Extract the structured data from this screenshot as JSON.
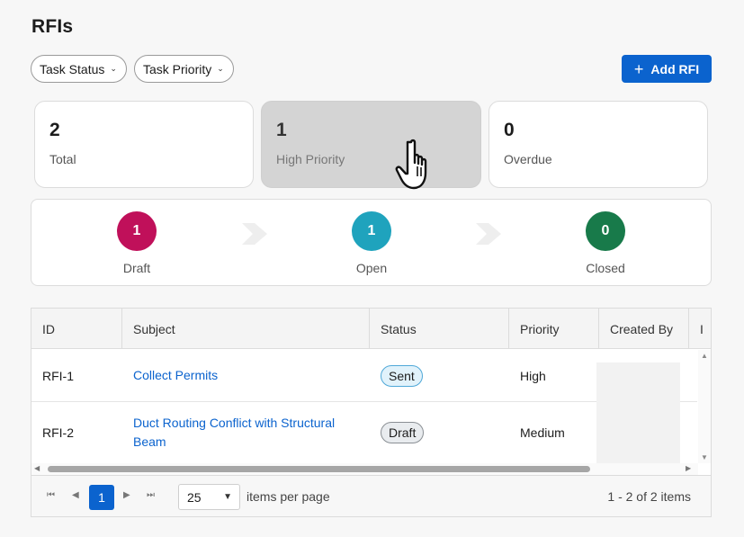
{
  "page": {
    "title": "RFIs"
  },
  "filters": {
    "status_label": "Task Status",
    "priority_label": "Task Priority"
  },
  "actions": {
    "add_label": "Add RFI"
  },
  "summary": {
    "total": {
      "value": "2",
      "label": "Total"
    },
    "high_priority": {
      "value": "1",
      "label": "High Priority"
    },
    "overdue": {
      "value": "0",
      "label": "Overdue"
    }
  },
  "workflow": {
    "steps": [
      {
        "count": "1",
        "label": "Draft",
        "color": "#c0105a"
      },
      {
        "count": "1",
        "label": "Open",
        "color": "#1fa3bd"
      },
      {
        "count": "0",
        "label": "Closed",
        "color": "#187a4a"
      }
    ]
  },
  "table": {
    "columns": [
      "ID",
      "Subject",
      "Status",
      "Priority",
      "Created By",
      "I"
    ],
    "rows": [
      {
        "id": "RFI-1",
        "subject": "Collect Permits",
        "status": "Sent",
        "priority": "High"
      },
      {
        "id": "RFI-2",
        "subject": "Duct Routing Conflict with Structural Beam",
        "status": "Draft",
        "priority": "Medium"
      }
    ]
  },
  "pager": {
    "current_page": "1",
    "page_size": "25",
    "items_per_page_label": "items per page",
    "summary": "1 - 2 of 2 items"
  },
  "colors": {
    "accent": "#0b63ce",
    "sent_badge": "#e1f2fb",
    "draft_badge": "#e9ecef"
  }
}
